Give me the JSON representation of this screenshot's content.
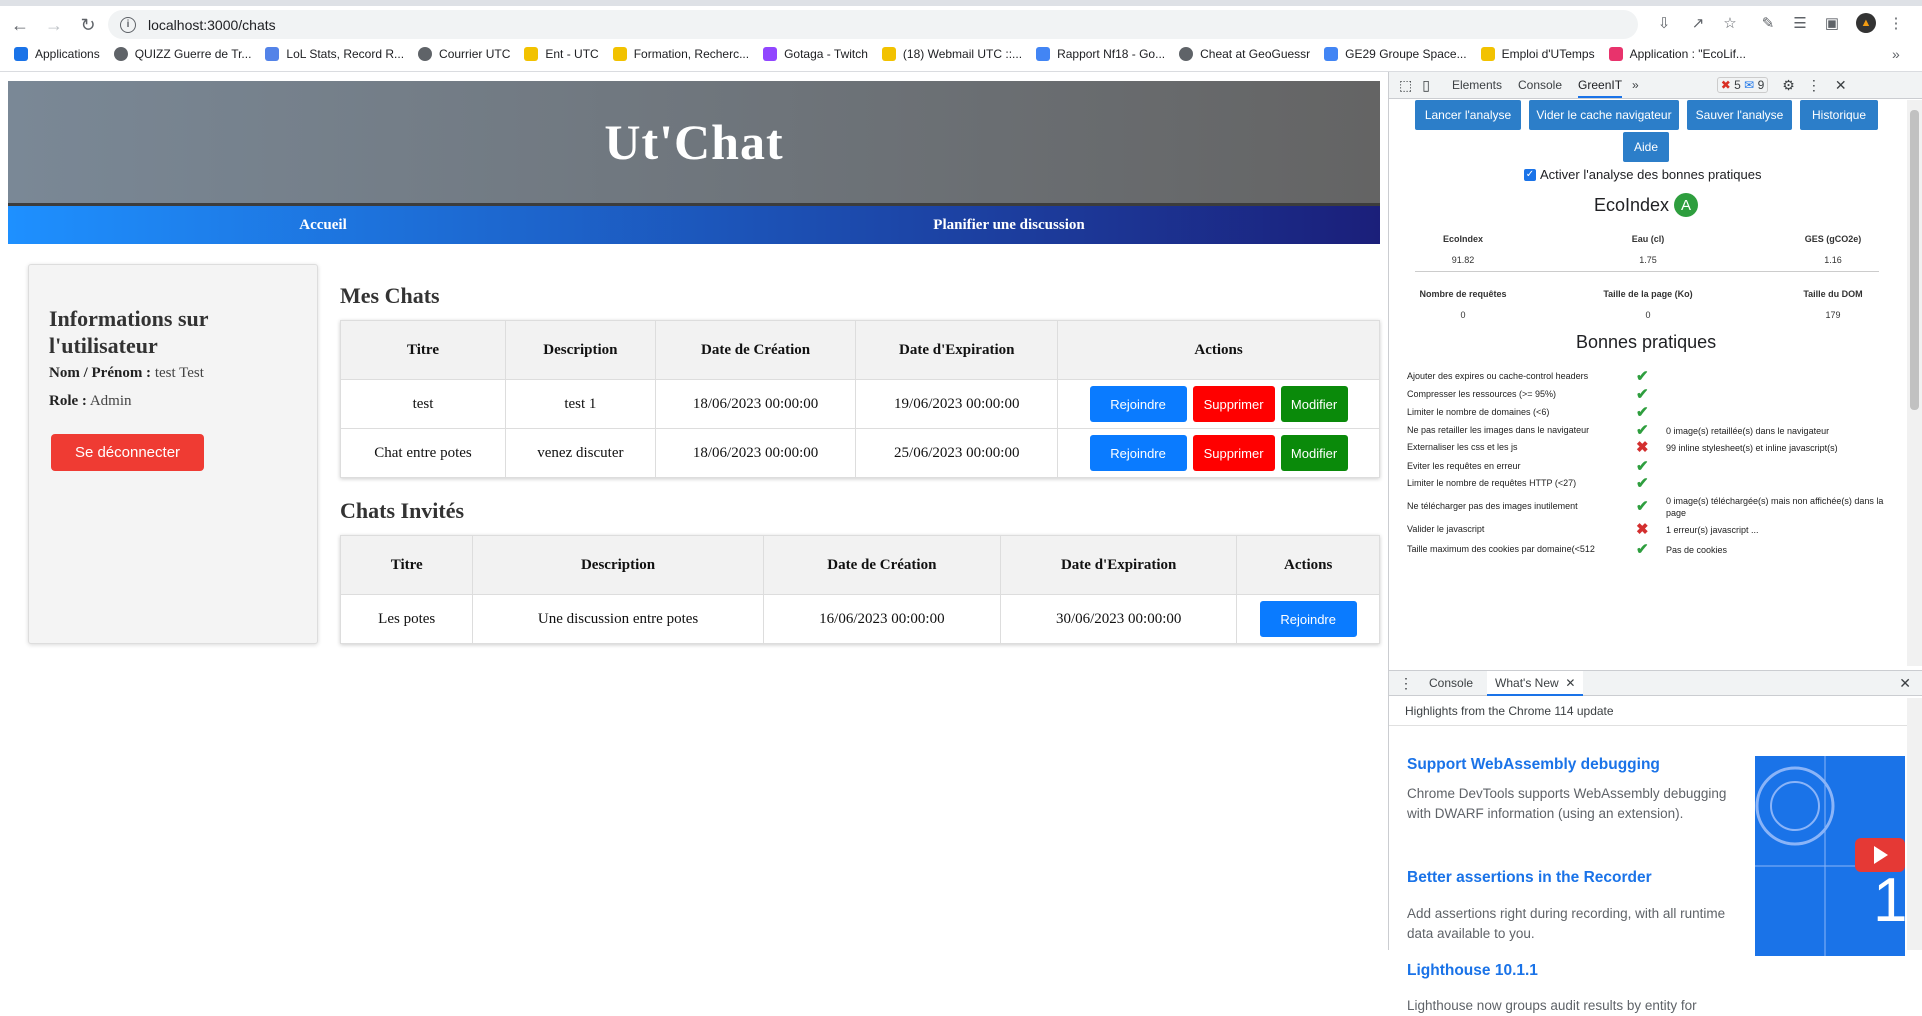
{
  "browser": {
    "url": "localhost:3000/chats",
    "bookmarks": [
      {
        "label": "Applications",
        "icon": "apps-grid-icon",
        "color": "#1a73e8"
      },
      {
        "label": "QUIZZ Guerre de Tr...",
        "icon": "globe-icon",
        "color": "#5f6368"
      },
      {
        "label": "LoL Stats, Record R...",
        "icon": "opgg-icon",
        "color": "#5383e8"
      },
      {
        "label": "Courrier  UTC",
        "icon": "globe-icon",
        "color": "#5f6368"
      },
      {
        "label": "Ent - UTC",
        "icon": "utc-icon",
        "color": "#f2c200"
      },
      {
        "label": "Formation, Recherc...",
        "icon": "utc-icon",
        "color": "#f2c200"
      },
      {
        "label": "Gotaga - Twitch",
        "icon": "twitch-icon",
        "color": "#9146ff"
      },
      {
        "label": "(18) Webmail UTC ::...",
        "icon": "webmail-icon",
        "color": "#f2c200"
      },
      {
        "label": "Rapport Nf18 - Go...",
        "icon": "docs-icon",
        "color": "#4285f4"
      },
      {
        "label": "Cheat at GeoGuessr",
        "icon": "globe-icon",
        "color": "#5f6368"
      },
      {
        "label": "GE29 Groupe Space...",
        "icon": "docs-icon",
        "color": "#4285f4"
      },
      {
        "label": "Emploi d'UTemps",
        "icon": "utc-icon",
        "color": "#f2c200"
      },
      {
        "label": "Application : \"EcoLif...",
        "icon": "ecolif-icon",
        "color": "#e8336c"
      }
    ]
  },
  "site": {
    "title": "Ut'Chat",
    "nav": [
      "Accueil",
      "Planifier une discussion"
    ]
  },
  "user": {
    "heading": "Informations sur l'utilisateur",
    "name_label": "Nom / Prénom :",
    "name_value": "test Test",
    "role_label": "Role :",
    "role_value": "Admin",
    "logout": "Se déconnecter"
  },
  "my_chats": {
    "title": "Mes Chats",
    "columns": [
      "Titre",
      "Description",
      "Date de Création",
      "Date d'Expiration",
      "Actions"
    ],
    "rows": [
      [
        "test",
        "test 1",
        "18/06/2023 00:00:00",
        "19/06/2023 00:00:00"
      ],
      [
        "Chat entre potes",
        "venez discuter",
        "18/06/2023 00:00:00",
        "25/06/2023 00:00:00"
      ]
    ],
    "actions": [
      "Rejoindre",
      "Supprimer",
      "Modifier"
    ]
  },
  "invited_chats": {
    "title": "Chats Invités",
    "columns": [
      "Titre",
      "Description",
      "Date de Création",
      "Date d'Expiration",
      "Actions"
    ],
    "rows": [
      [
        "Les potes",
        "Une discussion entre potes",
        "16/06/2023 00:00:00",
        "30/06/2023 00:00:00"
      ]
    ],
    "action": "Rejoindre"
  },
  "devtools": {
    "tabs": [
      "Elements",
      "Console",
      "GreenIT"
    ],
    "errors": "5",
    "messages": "9",
    "greenit": {
      "buttons": [
        "Lancer l'analyse",
        "Vider le cache navigateur",
        "Sauver l'analyse",
        "Historique",
        "Aide"
      ],
      "checkbox_label": "Activer l'analyse des bonnes pratiques",
      "ecoindex_title": "EcoIndex",
      "ecoindex_grade": "A",
      "metrics_row1": [
        {
          "label": "EcoIndex",
          "value": "91.82"
        },
        {
          "label": "Eau (cl)",
          "value": "1.75"
        },
        {
          "label": "GES (gCO2e)",
          "value": "1.16"
        }
      ],
      "metrics_row2": [
        {
          "label": "Nombre de requêtes",
          "value": "0"
        },
        {
          "label": "Taille de la page (Ko)",
          "value": "0"
        },
        {
          "label": "Taille du DOM",
          "value": "179"
        }
      ],
      "practices_title": "Bonnes pratiques",
      "practices": [
        {
          "rule": "Ajouter des expires ou cache-control headers",
          "ok": true,
          "note": ""
        },
        {
          "rule": "Compresser les ressources (>= 95%)",
          "ok": true,
          "note": ""
        },
        {
          "rule": "Limiter le nombre de domaines (<6)",
          "ok": true,
          "note": ""
        },
        {
          "rule": "Ne pas retailler les images dans le navigateur",
          "ok": true,
          "note": "0 image(s) retaillée(s) dans le navigateur"
        },
        {
          "rule": "Externaliser les css et les js",
          "ok": false,
          "note": "99 inline stylesheet(s) et inline javascript(s)"
        },
        {
          "rule": "Eviter les requêtes en erreur",
          "ok": true,
          "note": ""
        },
        {
          "rule": "Limiter le nombre de requêtes HTTP (<27)",
          "ok": true,
          "note": ""
        },
        {
          "rule": "Ne télécharger pas des images inutilement",
          "ok": true,
          "note": "0 image(s) téléchargée(s) mais non affichée(s) dans la page"
        },
        {
          "rule": "Valider le javascript",
          "ok": false,
          "note": "1 erreur(s) javascript ..."
        },
        {
          "rule": "Taille maximum des cookies par domaine(<512",
          "ok": true,
          "note": "Pas de cookies"
        }
      ]
    },
    "drawer": {
      "tabs": [
        "Console",
        "What's New"
      ],
      "subtitle": "Highlights from the Chrome 114 update",
      "items": [
        {
          "title": "Support WebAssembly debugging",
          "body": "Chrome DevTools supports WebAssembly debugging with DWARF information (using an extension)."
        },
        {
          "title": "Better assertions in the Recorder",
          "body": "Add assertions right during recording, with all runtime data available to you."
        },
        {
          "title": "Lighthouse 10.1.1",
          "body": "Lighthouse now groups audit results by entity for"
        }
      ]
    }
  }
}
